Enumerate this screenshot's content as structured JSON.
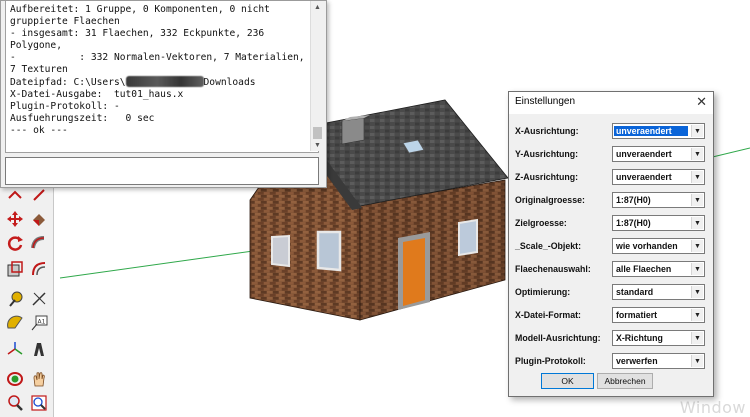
{
  "console": {
    "lines": [
      "Aufbereitet: 1 Gruppe, 0 Komponenten, 0 nicht",
      "gruppierte Flaechen",
      "- insgesamt: 31 Flaechen, 332 Eckpunkte, 236",
      "Polygone,",
      "-           : 332 Normalen-Vektoren, 7 Materialien,",
      "7 Texturen"
    ],
    "path_prefix": "Dateipfad: C:\\Users\\",
    "path_suffix": "Downloads",
    "lines_after": [
      "X-Datei-Ausgabe:  tut01_haus.x",
      "Plugin-Protokoll: -",
      "Ausfuehrungszeit:   0 sec",
      "--- ok ---"
    ],
    "input_value": ""
  },
  "dialog": {
    "title": "Einstellungen",
    "close_glyph": "✕",
    "rows": [
      {
        "label": "X-Ausrichtung:",
        "value": "unveraendert"
      },
      {
        "label": "Y-Ausrichtung:",
        "value": "unveraendert"
      },
      {
        "label": "Z-Ausrichtung:",
        "value": "unveraendert"
      },
      {
        "label": "Originalgroesse:",
        "value": "1:87(H0)"
      },
      {
        "label": "Zielgroesse:",
        "value": "1:87(H0)"
      },
      {
        "label": "_Scale_-Objekt:",
        "value": "wie vorhanden"
      },
      {
        "label": "Flaechenauswahl:",
        "value": "alle Flaechen"
      },
      {
        "label": "Optimierung:",
        "value": "standard"
      },
      {
        "label": "X-Datei-Format:",
        "value": "formatiert"
      },
      {
        "label": "Modell-Ausrichtung:",
        "value": "X-Richtung"
      },
      {
        "label": "Plugin-Protokoll:",
        "value": "verwerfen"
      }
    ],
    "ok_label": "OK",
    "cancel_label": "Abbrechen"
  },
  "watermark": "Window",
  "colors": {
    "accent_selection": "#0a64d8",
    "axis_green": "#2fa84a",
    "brick": "#7a4a2e",
    "roof": "#4e4e4e",
    "door": "#e07a1c"
  },
  "toolbar_icons": [
    "move-icon",
    "paint-bucket-icon",
    "rotate-icon",
    "follow-me-icon",
    "scale-icon",
    "offset-icon",
    "tape-measure-icon",
    "dimension-icon",
    "protractor-icon",
    "text-icon",
    "axes-icon",
    "3d-text-icon",
    "orbit-icon",
    "pan-icon",
    "zoom-icon",
    "zoom-window-icon"
  ]
}
